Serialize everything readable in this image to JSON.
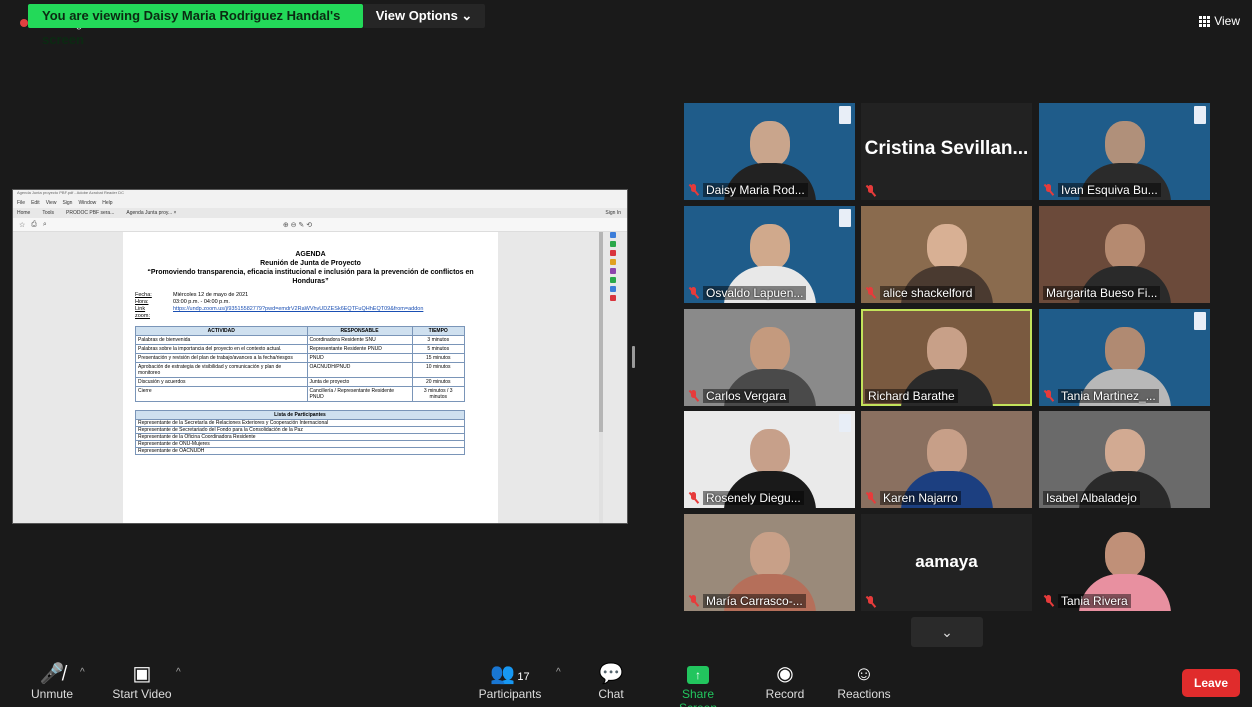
{
  "top": {
    "share_banner": "You are viewing Daisy Maria Rodriguez Handal's screen",
    "view_options": "View Options ⌄",
    "recording": "Recording",
    "view_label": "View"
  },
  "doc": {
    "title_bar": "Agenda Junta proyecto PBF.pdf - Adobe Acrobat Reader DC",
    "menu": [
      "File",
      "Edit",
      "View",
      "Sign",
      "Window",
      "Help"
    ],
    "tabs": [
      "Home",
      "Tools",
      "PRODOC PBF sera...",
      "Agenda Junta proy... ×"
    ],
    "sign_in": "Sign In",
    "heading1": "AGENDA",
    "heading2": "Reunión de Junta de Proyecto",
    "heading3": "“Promoviendo transparencia, eficacia institucional e inclusión para la prevención de conflictos en Honduras”",
    "fecha_lbl": "Fecha:",
    "fecha_val": "Miércoles 12 de mayo de 2021",
    "hora_lbl": "Hora:",
    "hora_val": "03:00 p.m. - 04:00 p.m.",
    "link_lbl": "Link zoom:",
    "link_val": "https://undp.zoom.us/j/93515582779?pwd=emdrV2RaWVhvUDZESk6EQTFuQHhEQT09&from=addon",
    "agenda_headers": [
      "ACTIVIDAD",
      "RESPONSABLE",
      "TIEMPO"
    ],
    "agenda_rows": [
      [
        "Palabras de bienvenida",
        "Coordinadora Residente SNU",
        "3 minutos"
      ],
      [
        "Palabras sobre la importancia del proyecto en el contexto actual.",
        "Representante Residente PNUD",
        "5 minutos"
      ],
      [
        "Presentación y revisión del plan de trabajo/avances a la fecha/riesgos",
        "PNUD",
        "15 minutos"
      ],
      [
        "Aprobación de estrategia de visibilidad y comunicación y plan de monitoreo",
        "OACNUDH/PNUD",
        "10 minutos"
      ],
      [
        "Discusión y acuerdos",
        "Junta de proyecto",
        "20 minutos"
      ],
      [
        "Cierre",
        "Cancillería / Representante Residente PNUD",
        "3 minutos / 3 minutos"
      ]
    ],
    "participants_title": "Lista de Participantes",
    "participants": [
      "Representante de la Secretaría de Relaciones Exteriores y Cooperación Internacional",
      "Representante de Secretariado del Fondo para la Consolidación de la Paz",
      "Representante de la Oficina Coordinadora Residente",
      "Representante de ONU-Mujeres",
      "Representante de OACNUDH"
    ]
  },
  "tiles": [
    {
      "name": "Daisy Maria Rod...",
      "muted": true
    },
    {
      "name": "",
      "muted": true,
      "big": "Cristina  Sevillan..."
    },
    {
      "name": "Ivan Esquiva Bu...",
      "muted": true
    },
    {
      "name": "Osvaldo Lapuen...",
      "muted": true
    },
    {
      "name": "alice shackelford",
      "muted": true
    },
    {
      "name": "Margarita Bueso Fi...",
      "muted": false
    },
    {
      "name": "Carlos Vergara",
      "muted": true
    },
    {
      "name": "Richard Barathe",
      "muted": false
    },
    {
      "name": "Tania Martinez_...",
      "muted": true
    },
    {
      "name": "Rosenely Diegu...",
      "muted": true
    },
    {
      "name": "Karen Najarro",
      "muted": true
    },
    {
      "name": "Isabel Albaladejo",
      "muted": false
    },
    {
      "name": "María Carrasco-...",
      "muted": true
    },
    {
      "name": "",
      "muted": true,
      "big": "aamaya"
    },
    {
      "name": "Tania Rivera",
      "muted": true
    }
  ],
  "toolbar": {
    "unmute": "Unmute",
    "start_video": "Start Video",
    "participants": "Participants",
    "participants_count": "17",
    "chat": "Chat",
    "share": "Share Screen",
    "record": "Record",
    "reactions": "Reactions",
    "leave": "Leave"
  },
  "colors": {
    "share_banner": "#23d959",
    "leave": "#e02c2c",
    "active_speaker": "#c3e35b"
  }
}
